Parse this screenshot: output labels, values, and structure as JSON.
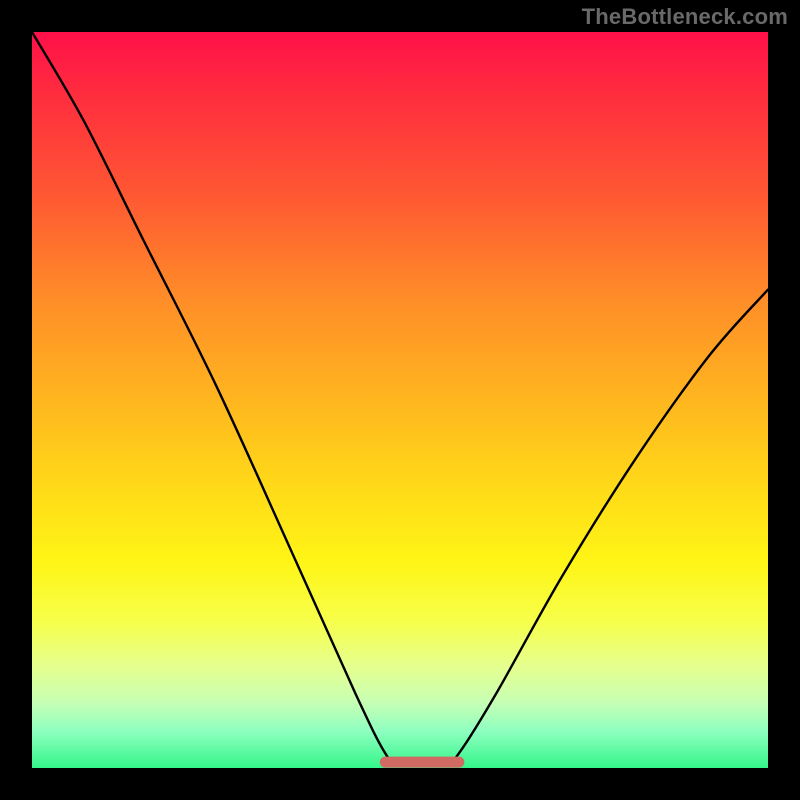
{
  "watermark": "TheBottleneck.com",
  "colors": {
    "flat_segment": "#d16a62",
    "curve": "#000000"
  },
  "chart_data": {
    "type": "line",
    "title": "",
    "xlabel": "",
    "ylabel": "",
    "x_range": [
      0,
      100
    ],
    "y_range": [
      0,
      100
    ],
    "series": [
      {
        "name": "bottleneck-curve",
        "points": [
          {
            "x": 0,
            "y": 100
          },
          {
            "x": 7,
            "y": 88
          },
          {
            "x": 15,
            "y": 72
          },
          {
            "x": 25,
            "y": 52
          },
          {
            "x": 35,
            "y": 30
          },
          {
            "x": 44,
            "y": 10
          },
          {
            "x": 48,
            "y": 2
          },
          {
            "x": 50,
            "y": 0.5
          },
          {
            "x": 56,
            "y": 0.5
          },
          {
            "x": 58,
            "y": 2
          },
          {
            "x": 63,
            "y": 10
          },
          {
            "x": 72,
            "y": 26
          },
          {
            "x": 82,
            "y": 42
          },
          {
            "x": 92,
            "y": 56
          },
          {
            "x": 100,
            "y": 65
          }
        ]
      }
    ],
    "flat_segment": {
      "x_start": 48,
      "x_end": 58,
      "y": 0.8
    },
    "annotations": []
  }
}
